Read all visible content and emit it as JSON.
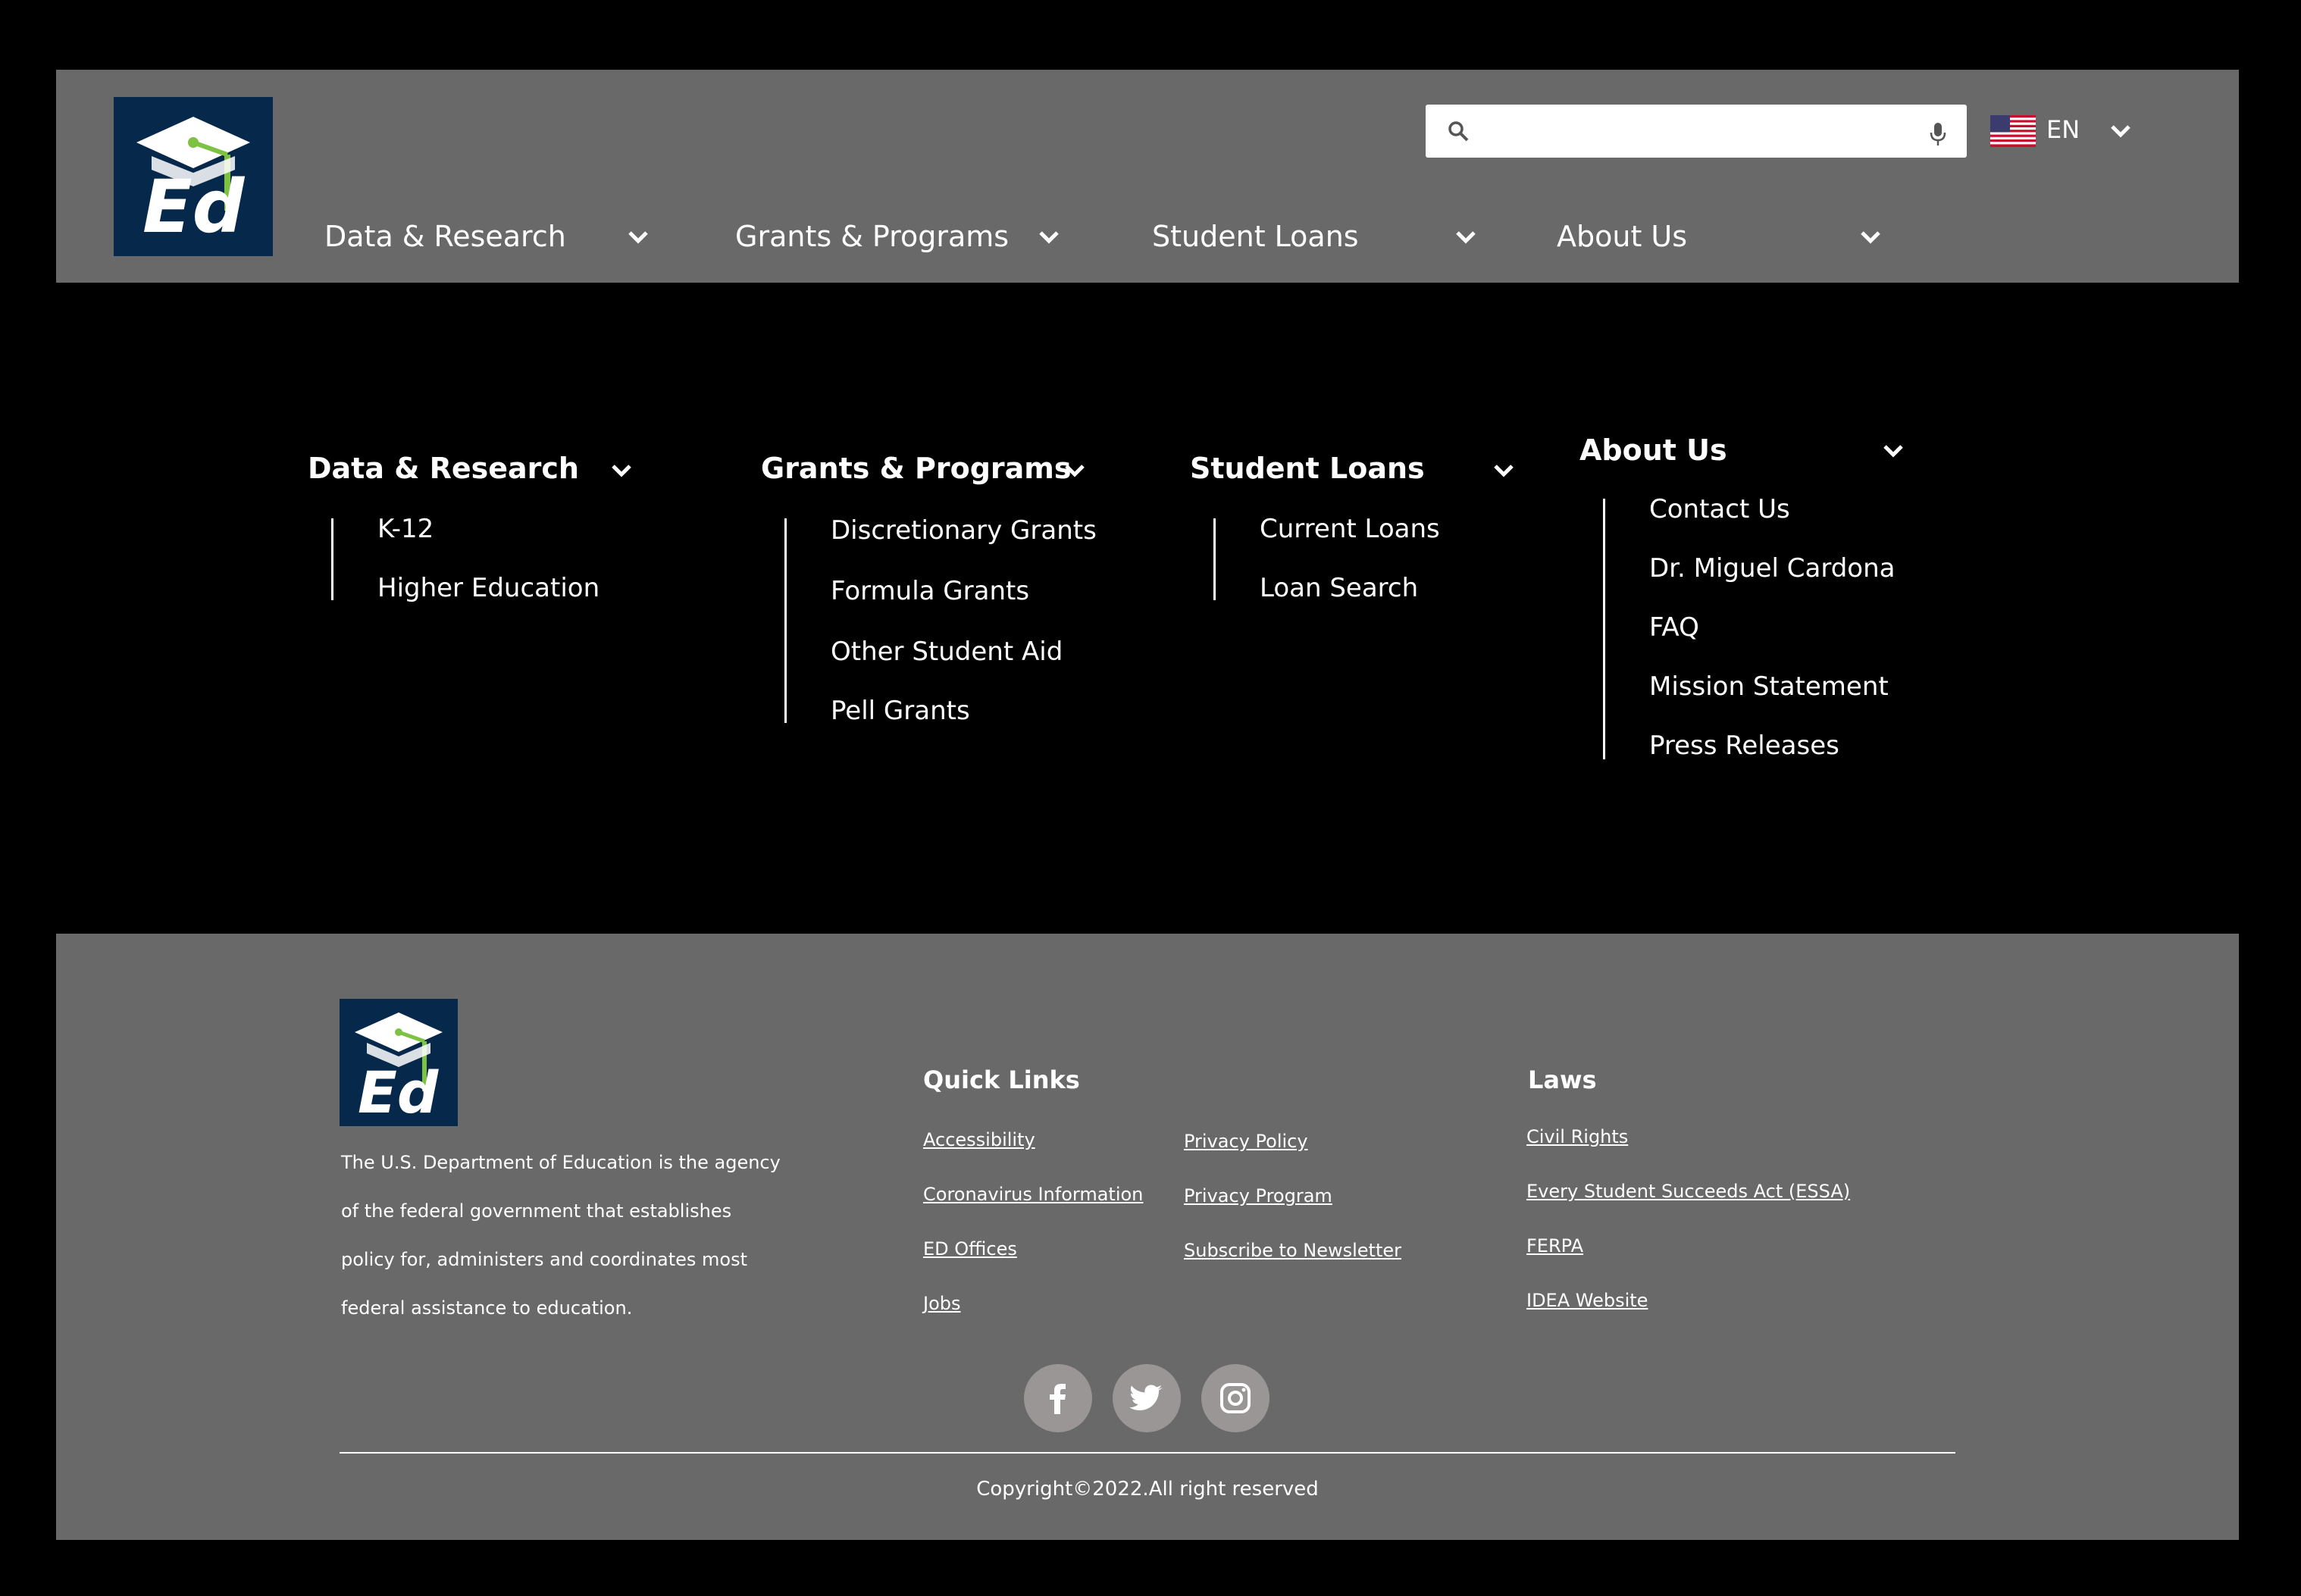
{
  "header": {
    "logo_text": "Ed",
    "search": {
      "value": "",
      "placeholder": ""
    },
    "language": "EN",
    "nav": [
      {
        "label": "Data & Research"
      },
      {
        "label": "Grants & Programs"
      },
      {
        "label": "Student Loans"
      },
      {
        "label": "About Us"
      }
    ]
  },
  "menu": {
    "columns": [
      {
        "title": "Data & Research",
        "items": [
          "K-12",
          "Higher Education"
        ]
      },
      {
        "title": "Grants & Programs",
        "items": [
          "Discretionary Grants",
          "Formula Grants",
          "Other Student Aid",
          "Pell Grants"
        ]
      },
      {
        "title": "Student Loans",
        "items": [
          "Current Loans",
          "Loan Search"
        ]
      },
      {
        "title": "About Us",
        "items": [
          "Contact Us",
          "Dr. Miguel Cardona",
          "FAQ",
          "Mission Statement",
          "Press Releases"
        ]
      }
    ]
  },
  "footer": {
    "logo_text": "Ed",
    "description": [
      "The U.S. Department of Education is the agency",
      "of the federal government that establishes",
      "policy for, administers and coordinates most",
      "federal assistance to education."
    ],
    "quick_links_title": "Quick Links",
    "quick_links_col1": [
      "Accessibility",
      "Coronavirus Information",
      "ED Offices",
      "Jobs"
    ],
    "quick_links_col2": [
      "Privacy Policy",
      "Privacy Program",
      "Subscribe to Newsletter"
    ],
    "laws_title": "Laws",
    "laws": [
      "Civil Rights",
      "Every Student Succeeds Act (ESSA)",
      "FERPA",
      "IDEA Website"
    ],
    "social": [
      "facebook-icon",
      "twitter-icon",
      "instagram-icon"
    ],
    "copyright": "Copyright©2022.All right reserved"
  },
  "colors": {
    "panel": "#696969",
    "logo_bg": "#06284a",
    "logo_accent": "#7dc242",
    "social_bg": "#9a9696"
  }
}
